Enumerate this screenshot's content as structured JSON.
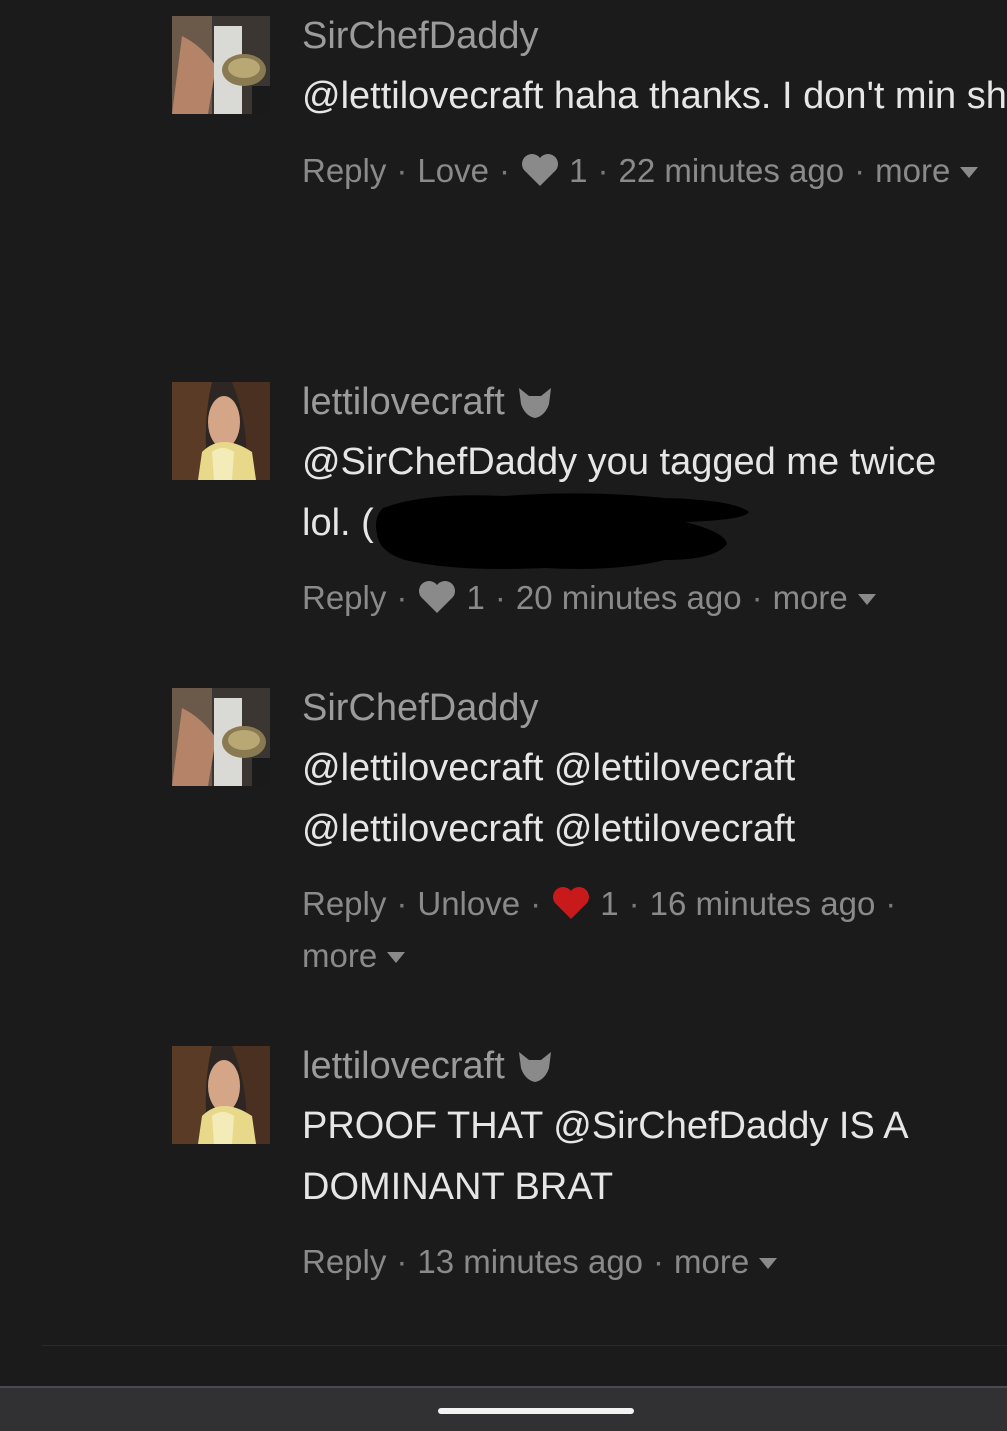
{
  "comments": [
    {
      "username": "SirChefDaddy",
      "text": "@lettilovecraft haha thanks. I don't min\nsharing the apron thing, we can do a\ncollab like @lettilovecraft said",
      "actions": {
        "reply": "Reply",
        "love": "Love",
        "count": "1",
        "time": "22 minutes ago",
        "more": "more"
      },
      "heart_color": "#8a8a8a"
    },
    {
      "username": "lettilovecraft",
      "text": "@SirChefDaddy you tagged me twice\nlol. (",
      "actions": {
        "reply": "Reply",
        "count": "1",
        "time": "20 minutes ago",
        "more": "more"
      },
      "heart_color": "#8a8a8a"
    },
    {
      "username": "SirChefDaddy",
      "text": "@lettilovecraft @lettilovecraft\n@lettilovecraft @lettilovecraft",
      "actions": {
        "reply": "Reply",
        "love": "Unlove",
        "count": "1",
        "time": "16 minutes ago",
        "more": "more"
      },
      "heart_color": "#c81a1a"
    },
    {
      "username": "lettilovecraft",
      "text": "PROOF THAT @SirChefDaddy IS A\nDOMINANT BRAT",
      "actions": {
        "reply": "Reply",
        "time": "13 minutes ago",
        "more": "more"
      }
    }
  ],
  "colors": {
    "background": "#1b1b1c",
    "liked_heart": "#c81a1a",
    "muted_text": "#8a8a8a"
  }
}
